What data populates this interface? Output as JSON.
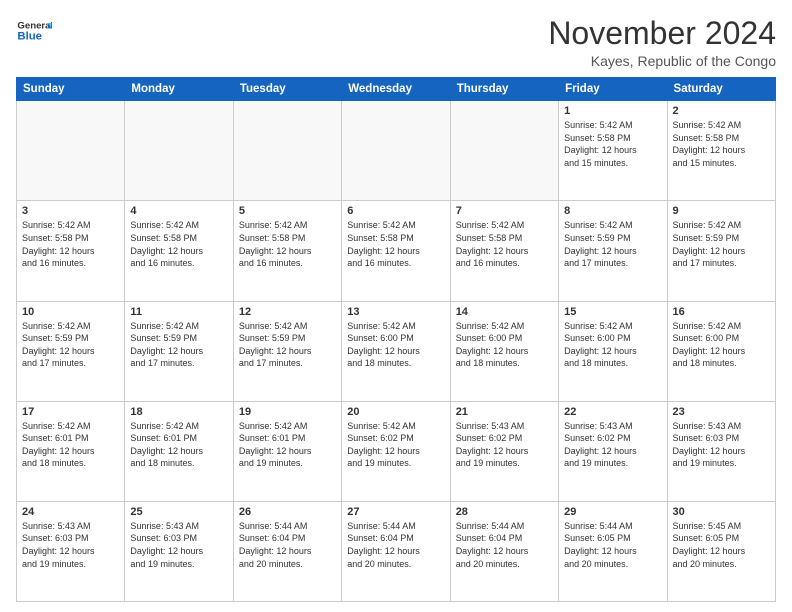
{
  "header": {
    "logo_line1": "General",
    "logo_line2": "Blue",
    "month_title": "November 2024",
    "location": "Kayes, Republic of the Congo"
  },
  "days_of_week": [
    "Sunday",
    "Monday",
    "Tuesday",
    "Wednesday",
    "Thursday",
    "Friday",
    "Saturday"
  ],
  "weeks": [
    [
      {
        "day": "",
        "info": ""
      },
      {
        "day": "",
        "info": ""
      },
      {
        "day": "",
        "info": ""
      },
      {
        "day": "",
        "info": ""
      },
      {
        "day": "",
        "info": ""
      },
      {
        "day": "1",
        "info": "Sunrise: 5:42 AM\nSunset: 5:58 PM\nDaylight: 12 hours\nand 15 minutes."
      },
      {
        "day": "2",
        "info": "Sunrise: 5:42 AM\nSunset: 5:58 PM\nDaylight: 12 hours\nand 15 minutes."
      }
    ],
    [
      {
        "day": "3",
        "info": "Sunrise: 5:42 AM\nSunset: 5:58 PM\nDaylight: 12 hours\nand 16 minutes."
      },
      {
        "day": "4",
        "info": "Sunrise: 5:42 AM\nSunset: 5:58 PM\nDaylight: 12 hours\nand 16 minutes."
      },
      {
        "day": "5",
        "info": "Sunrise: 5:42 AM\nSunset: 5:58 PM\nDaylight: 12 hours\nand 16 minutes."
      },
      {
        "day": "6",
        "info": "Sunrise: 5:42 AM\nSunset: 5:58 PM\nDaylight: 12 hours\nand 16 minutes."
      },
      {
        "day": "7",
        "info": "Sunrise: 5:42 AM\nSunset: 5:58 PM\nDaylight: 12 hours\nand 16 minutes."
      },
      {
        "day": "8",
        "info": "Sunrise: 5:42 AM\nSunset: 5:59 PM\nDaylight: 12 hours\nand 17 minutes."
      },
      {
        "day": "9",
        "info": "Sunrise: 5:42 AM\nSunset: 5:59 PM\nDaylight: 12 hours\nand 17 minutes."
      }
    ],
    [
      {
        "day": "10",
        "info": "Sunrise: 5:42 AM\nSunset: 5:59 PM\nDaylight: 12 hours\nand 17 minutes."
      },
      {
        "day": "11",
        "info": "Sunrise: 5:42 AM\nSunset: 5:59 PM\nDaylight: 12 hours\nand 17 minutes."
      },
      {
        "day": "12",
        "info": "Sunrise: 5:42 AM\nSunset: 5:59 PM\nDaylight: 12 hours\nand 17 minutes."
      },
      {
        "day": "13",
        "info": "Sunrise: 5:42 AM\nSunset: 6:00 PM\nDaylight: 12 hours\nand 18 minutes."
      },
      {
        "day": "14",
        "info": "Sunrise: 5:42 AM\nSunset: 6:00 PM\nDaylight: 12 hours\nand 18 minutes."
      },
      {
        "day": "15",
        "info": "Sunrise: 5:42 AM\nSunset: 6:00 PM\nDaylight: 12 hours\nand 18 minutes."
      },
      {
        "day": "16",
        "info": "Sunrise: 5:42 AM\nSunset: 6:00 PM\nDaylight: 12 hours\nand 18 minutes."
      }
    ],
    [
      {
        "day": "17",
        "info": "Sunrise: 5:42 AM\nSunset: 6:01 PM\nDaylight: 12 hours\nand 18 minutes."
      },
      {
        "day": "18",
        "info": "Sunrise: 5:42 AM\nSunset: 6:01 PM\nDaylight: 12 hours\nand 18 minutes."
      },
      {
        "day": "19",
        "info": "Sunrise: 5:42 AM\nSunset: 6:01 PM\nDaylight: 12 hours\nand 19 minutes."
      },
      {
        "day": "20",
        "info": "Sunrise: 5:42 AM\nSunset: 6:02 PM\nDaylight: 12 hours\nand 19 minutes."
      },
      {
        "day": "21",
        "info": "Sunrise: 5:43 AM\nSunset: 6:02 PM\nDaylight: 12 hours\nand 19 minutes."
      },
      {
        "day": "22",
        "info": "Sunrise: 5:43 AM\nSunset: 6:02 PM\nDaylight: 12 hours\nand 19 minutes."
      },
      {
        "day": "23",
        "info": "Sunrise: 5:43 AM\nSunset: 6:03 PM\nDaylight: 12 hours\nand 19 minutes."
      }
    ],
    [
      {
        "day": "24",
        "info": "Sunrise: 5:43 AM\nSunset: 6:03 PM\nDaylight: 12 hours\nand 19 minutes."
      },
      {
        "day": "25",
        "info": "Sunrise: 5:43 AM\nSunset: 6:03 PM\nDaylight: 12 hours\nand 19 minutes."
      },
      {
        "day": "26",
        "info": "Sunrise: 5:44 AM\nSunset: 6:04 PM\nDaylight: 12 hours\nand 20 minutes."
      },
      {
        "day": "27",
        "info": "Sunrise: 5:44 AM\nSunset: 6:04 PM\nDaylight: 12 hours\nand 20 minutes."
      },
      {
        "day": "28",
        "info": "Sunrise: 5:44 AM\nSunset: 6:04 PM\nDaylight: 12 hours\nand 20 minutes."
      },
      {
        "day": "29",
        "info": "Sunrise: 5:44 AM\nSunset: 6:05 PM\nDaylight: 12 hours\nand 20 minutes."
      },
      {
        "day": "30",
        "info": "Sunrise: 5:45 AM\nSunset: 6:05 PM\nDaylight: 12 hours\nand 20 minutes."
      }
    ]
  ]
}
